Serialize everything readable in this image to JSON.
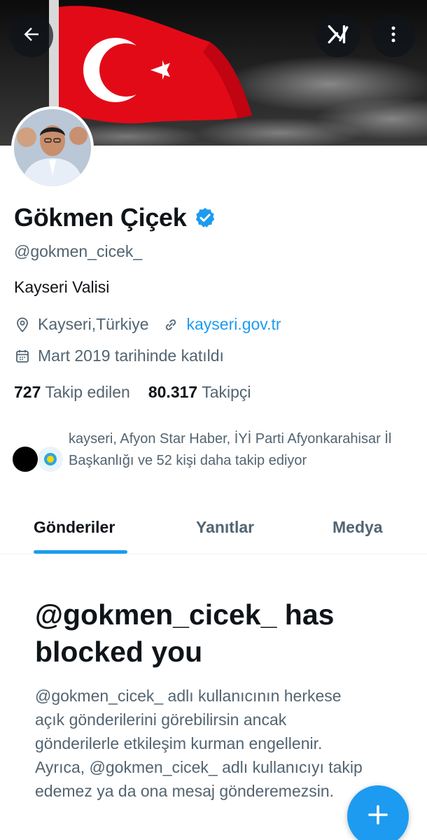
{
  "profile": {
    "display_name": "Gökmen Çiçek",
    "handle": "@gokmen_cicek_",
    "bio": "Kayseri Valisi",
    "location": "Kayseri,Türkiye",
    "website": "kayseri.gov.tr",
    "joined": "Mart 2019 tarihinde katıldı",
    "following_count": "727",
    "following_label": "Takip edilen",
    "followers_count": "80.317",
    "followers_label": "Takipçi",
    "known_followers_text": "kayseri, Afyon Star Haber, İYİ Parti Afyonkarahisar İl Başkanlığı ve 52 kişi daha takip ediyor"
  },
  "tabs": [
    {
      "label": "Gönderiler",
      "active": true
    },
    {
      "label": "Yanıtlar",
      "active": false
    },
    {
      "label": "Medya",
      "active": false
    }
  ],
  "blocked": {
    "title": "@gokmen_cicek_ has blocked you",
    "text": "@gokmen_cicek_ adlı kullanıcının herkese açık gönderilerini görebilirsin ancak gönderilerle etkileşim kurman engellenir. Ayrıca, @gokmen_cicek_ adlı kullanıcıyı takip edemez ya da ona mesaj gönderemezsin."
  },
  "icons": {
    "back": "arrow-left-icon",
    "xai": "grok-icon",
    "more": "more-vertical-icon",
    "verified": "verified-badge-icon",
    "location": "location-pin-icon",
    "link": "link-icon",
    "calendar": "calendar-icon",
    "compose": "plus-icon"
  },
  "colors": {
    "accent": "#1d9bf0",
    "text_primary": "#0f1419",
    "text_secondary": "#536471",
    "flag_red": "#e30a17"
  }
}
